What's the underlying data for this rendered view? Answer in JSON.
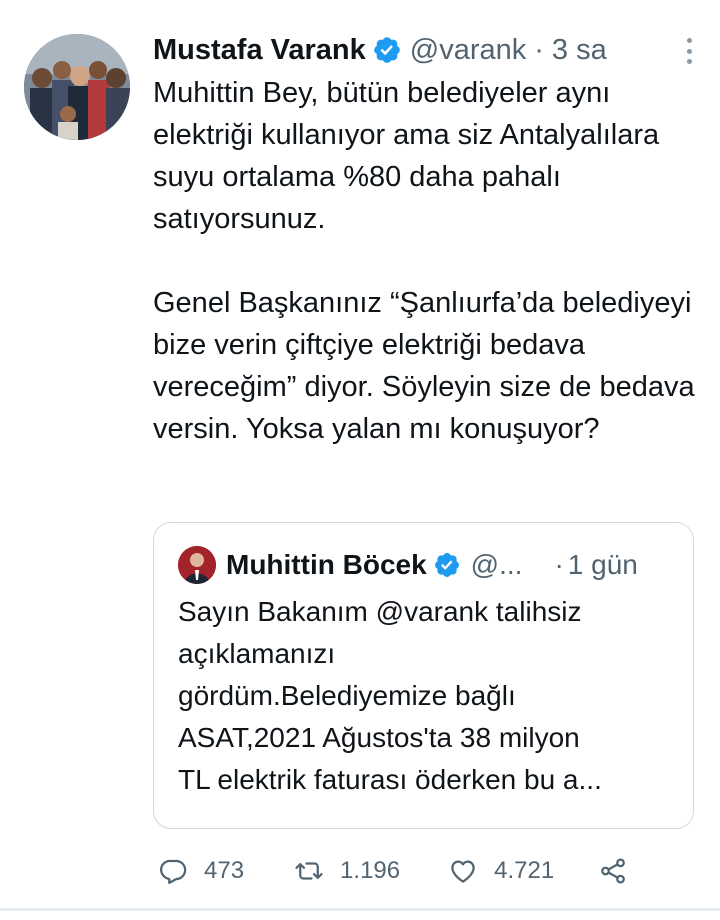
{
  "tweet": {
    "author_name": "Mustafa Varank",
    "handle": "@varank",
    "separator": "·",
    "time": "3 sa",
    "paragraphs": [
      "Muhittin Bey, bütün belediyeler aynı elektriği kullanıyor ama siz Antalyalılara suyu ortalama %80 daha pahalı satıyorsunuz.",
      "Genel Başkanınız “Şanlıurfa’da belediyeyi bize verin çiftçiye elektriği bedava vereceğim” diyor. Söyleyin size de bedava versin. Yoksa yalan mı konuşuyor?"
    ]
  },
  "quoted": {
    "author_name": "Muhittin Böcek",
    "handle": "@...",
    "separator": "·",
    "time": "1 gün",
    "lines": [
      "Sayın Bakanım @varank talihsiz",
      "açıklamanızı",
      "gördüm.Belediyemize bağlı",
      "ASAT,2021 Ağustos'ta 38 milyon",
      "TL elektrik faturası öderken bu a..."
    ]
  },
  "actions": {
    "reply_count": "473",
    "retweet_count": "1.196",
    "like_count": "4.721"
  },
  "colors": {
    "verified": "#1d9bf0",
    "secondary_text": "#536471",
    "border": "#cfd9de"
  },
  "icons": {
    "verified": "verified-badge-icon",
    "more": "more-vertical-icon",
    "reply": "reply-icon",
    "retweet": "retweet-icon",
    "like": "heart-icon",
    "share": "share-icon"
  }
}
